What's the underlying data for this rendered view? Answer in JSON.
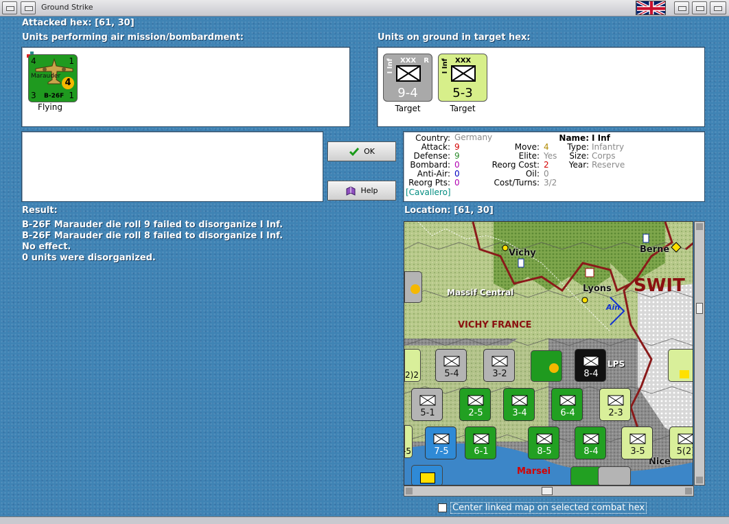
{
  "window": {
    "title": "Ground Strike"
  },
  "attacked_hex": {
    "label": "Attacked hex:",
    "coords": "[61, 30]"
  },
  "air_units": {
    "header": "Units performing air mission/bombardment:",
    "unit": {
      "name": "Marauder",
      "model": "B-26F",
      "attack": "4",
      "strength": "1",
      "defense": "3",
      "bottom_right": "1",
      "badge": "4",
      "status": "Flying"
    }
  },
  "ground_units": {
    "header": "Units on ground in target hex:",
    "units": [
      {
        "size": "XXX",
        "name": "I Inf",
        "reserve": "R",
        "stats": "9-4",
        "status": "Target",
        "color": "#a9a9a9"
      },
      {
        "size": "XXX",
        "name": "I Inf",
        "stats": "5-3",
        "status": "Target",
        "color": "#d7ef8a"
      }
    ]
  },
  "buttons": {
    "ok": "OK",
    "help": "Help"
  },
  "unit_info": {
    "country_label": "Country:",
    "country": "Germany",
    "attack_label": "Attack:",
    "attack": "9",
    "defense_label": "Defense:",
    "defense": "9",
    "bombard_label": "Bombard:",
    "bombard": "0",
    "antiair_label": "Anti-Air:",
    "antiair": "0",
    "reorg_label": "Reorg Pts:",
    "reorg": "0",
    "leader": "[Cavallero]",
    "move_label": "Move:",
    "move": "4",
    "elite_label": "Elite:",
    "elite": "Yes",
    "reorg_cost_label": "Reorg Cost:",
    "reorg_cost": "2",
    "oil_label": "Oil:",
    "oil": "0",
    "cost_label": "Cost/Turns:",
    "cost": "3/2",
    "name_label": "Name:",
    "name": "I Inf",
    "type_label": "Type:",
    "type": "Infantry",
    "size_label": "Size:",
    "size": "Corps",
    "year_label": "Year:",
    "year": "Reserve"
  },
  "result": {
    "header": "Result:",
    "lines": [
      "B-26F Marauder die roll 9 failed to disorganize I Inf.",
      "B-26F Marauder die roll 8 failed to disorganize I Inf.",
      "No effect.",
      "0 units were disorganized."
    ]
  },
  "location": {
    "label": "Location:",
    "coords": "[61, 30]"
  },
  "map": {
    "labels": {
      "vichy": "Vichy",
      "massif": "Massif Central",
      "vichy_france": "VICHY FRANCE",
      "lyons": "Lyons",
      "ain": "Ain",
      "berne": "Berne",
      "swit": "SWIT",
      "alps": "LPS",
      "marseille": "Marsei",
      "nice": "Nice"
    },
    "counters": [
      {
        "stats": "5-4",
        "color": "#b4b4b4"
      },
      {
        "stats": "3-2",
        "color": "#b4b4b4"
      },
      {
        "stats": "8-4",
        "color": "#111111"
      },
      {
        "stats": "5-1",
        "color": "#b4b4b4"
      },
      {
        "stats": "2-5",
        "color": "#22a022"
      },
      {
        "stats": "3-4",
        "color": "#22a022"
      },
      {
        "stats": "6-4",
        "color": "#22a022"
      },
      {
        "stats": "2-3",
        "color": "#d9ef9a"
      },
      {
        "stats": "7-5",
        "color": "#2f8ad6"
      },
      {
        "stats": "6-1",
        "color": "#22a022"
      },
      {
        "stats": "8-5",
        "color": "#22a022"
      },
      {
        "stats": "8-4",
        "color": "#22a022"
      },
      {
        "stats": "3-5",
        "color": "#d9ef9a"
      },
      {
        "stats": "5(2)",
        "color": "#d9ef9a"
      }
    ],
    "edge_stats": [
      "2)2",
      "-5"
    ]
  },
  "center_checkbox": {
    "label": "Center linked map on selected combat hex",
    "checked": false
  },
  "colors": {
    "red": "#d40000",
    "green": "#2a8a2a",
    "purple": "#b000b0",
    "blue": "#0000c0",
    "gray": "#8a8a8a",
    "teal": "#008c80"
  }
}
